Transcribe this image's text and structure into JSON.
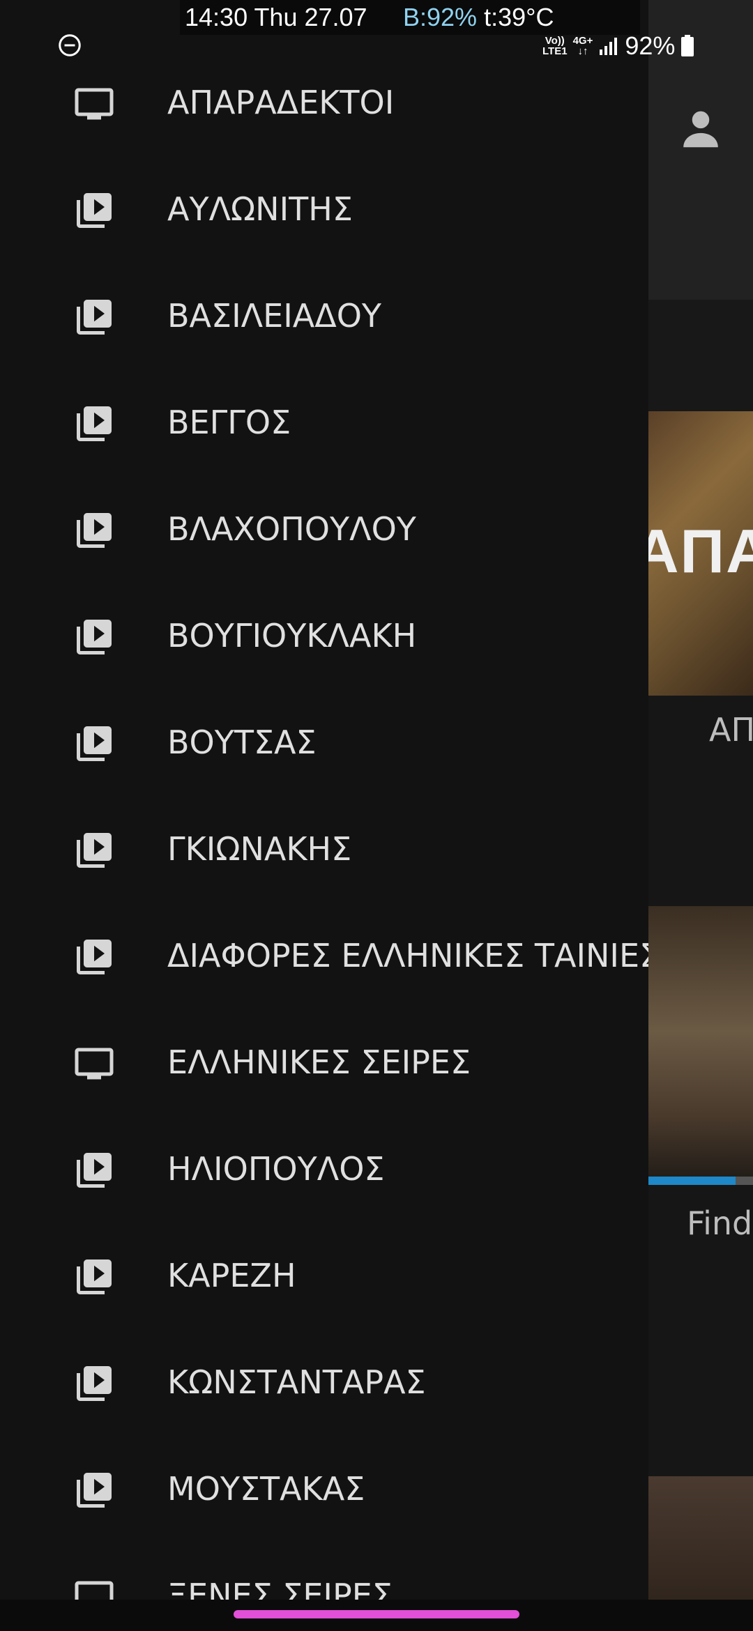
{
  "status_bar": {
    "time_date": "14:30 Thu 27.07",
    "battery_label": "B:92%",
    "temperature": "t:39°C",
    "volte": "Vo))",
    "lte": "LTE1",
    "network": "4G+",
    "battery_percent": "92%"
  },
  "background": {
    "card_1_overlay_text": "ΑΠΑΡ",
    "card_1_title": "ΑΠ",
    "card_2_title": "Find",
    "card_2_progress": 0.83
  },
  "drawer": {
    "items": [
      {
        "label": "ΑΠΑΡΑΔΕΚΤΟΙ",
        "icon": "tv-icon"
      },
      {
        "label": "ΑΥΛΩΝΙΤΗΣ",
        "icon": "video-library-icon"
      },
      {
        "label": "ΒΑΣΙΛΕΙΑΔΟΥ",
        "icon": "video-library-icon"
      },
      {
        "label": "ΒΕΓΓΟΣ",
        "icon": "video-library-icon"
      },
      {
        "label": "ΒΛΑΧΟΠΟΥΛΟΥ",
        "icon": "video-library-icon"
      },
      {
        "label": "ΒΟΥΓΙΟΥΚΛΑΚΗ",
        "icon": "video-library-icon"
      },
      {
        "label": "ΒΟΥΤΣΑΣ",
        "icon": "video-library-icon"
      },
      {
        "label": "ΓΚΙΩΝΑΚΗΣ",
        "icon": "video-library-icon"
      },
      {
        "label": "ΔΙΑΦΟΡΕΣ ΕΛΛΗΝΙΚΕΣ ΤΑΙΝΙΕΣ",
        "icon": "video-library-icon"
      },
      {
        "label": "ΕΛΛΗΝΙΚΕΣ ΣΕΙΡΕΣ",
        "icon": "tv-icon"
      },
      {
        "label": "ΗΛΙΟΠΟΥΛΟΣ",
        "icon": "video-library-icon"
      },
      {
        "label": "ΚΑΡΕΖΗ",
        "icon": "video-library-icon"
      },
      {
        "label": "ΚΩΝΣΤΑΝΤΑΡΑΣ",
        "icon": "video-library-icon"
      },
      {
        "label": "ΜΟΥΣΤΑΚΑΣ",
        "icon": "video-library-icon"
      },
      {
        "label": "ΞΕΝΕΣ ΣΕΙΡΕΣ",
        "icon": "tv-icon"
      }
    ]
  },
  "colors": {
    "drawer_bg": "#121212",
    "text": "#e0e0e0",
    "icon": "#d6d6d6",
    "gesture_pill": "#e24fd8",
    "progress": "#1e88c8"
  }
}
